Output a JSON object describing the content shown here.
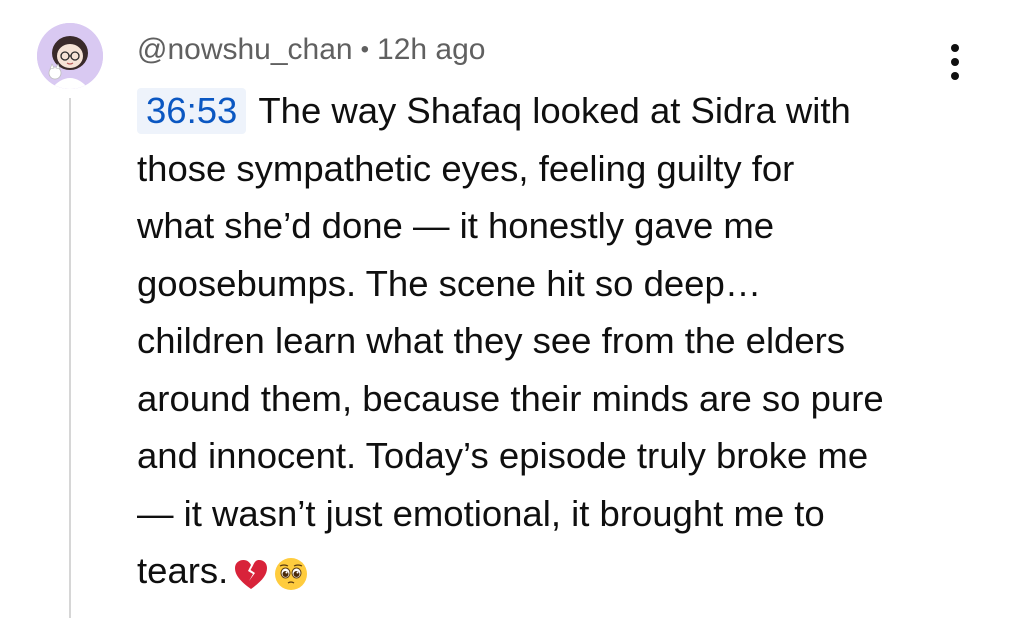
{
  "comment": {
    "author": "@nowshu_chan",
    "separator": "•",
    "time_ago": "12h ago",
    "timestamp_link": "36:53",
    "lines": [
      "The way Shafaq looked at Sidra with",
      "those sympathetic eyes, feeling guilty for",
      "what she’d done — it honestly gave me",
      "goosebumps. The scene hit so deep…",
      "children learn what they see from the elders",
      "around them, because their minds are so pure",
      "and innocent. Today’s episode truly broke me",
      "— it wasn’t just emotional, it brought me to",
      "tears."
    ],
    "emojis": [
      "broken-heart-icon",
      "pleading-face-icon"
    ]
  },
  "menu": {
    "icon": "more-vertical-icon"
  },
  "colors": {
    "timestamp_text": "#0b57c2",
    "timestamp_bg": "#eef3fb",
    "meta_text": "#606060",
    "body_text": "#0f0f0f",
    "thread_line": "#d6d6d6",
    "avatar_bg": "#d9c9f2"
  }
}
